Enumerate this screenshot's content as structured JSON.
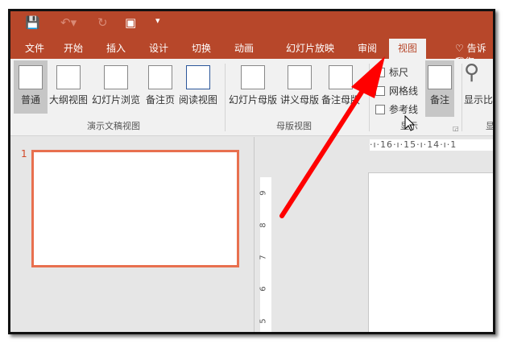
{
  "quick_access": {
    "save_icon": "save-icon",
    "undo_icon": "undo-icon",
    "redo_icon": "redo-icon",
    "present_icon": "present-from-start-icon",
    "customize_icon": "customize-qat-icon"
  },
  "tabs": [
    {
      "label": "文件"
    },
    {
      "label": "开始"
    },
    {
      "label": "插入"
    },
    {
      "label": "设计"
    },
    {
      "label": "切换"
    },
    {
      "label": "动画"
    },
    {
      "label": "幻灯片放映"
    },
    {
      "label": "审阅"
    },
    {
      "label": "视图",
      "active": true
    }
  ],
  "tell_me": "告诉我您",
  "ribbon": {
    "presentation_views": {
      "label": "演示文稿视图",
      "buttons": [
        "普通",
        "大纲视图",
        "幻灯片浏览",
        "备注页",
        "阅读视图"
      ]
    },
    "master_views": {
      "label": "母版视图",
      "buttons": [
        "幻灯片母版",
        "讲义母版",
        "备注母版"
      ]
    },
    "show": {
      "label": "显示",
      "checkboxes": [
        {
          "label": "标尺",
          "checked": false
        },
        {
          "label": "网格线",
          "checked": false
        },
        {
          "label": "参考线",
          "checked": false
        }
      ],
      "notes": "备注"
    },
    "zoom": {
      "label": "显示比",
      "group": "显"
    }
  },
  "slide_panel": {
    "slide_number": "1"
  },
  "ruler": {
    "horizontal": [
      "16",
      "15",
      "14"
    ],
    "vertical": [
      "9",
      "8",
      "7",
      "6",
      "5"
    ]
  },
  "colors": {
    "accent": "#b7472a",
    "selection": "#e8704f",
    "arrow": "#ff0000"
  }
}
